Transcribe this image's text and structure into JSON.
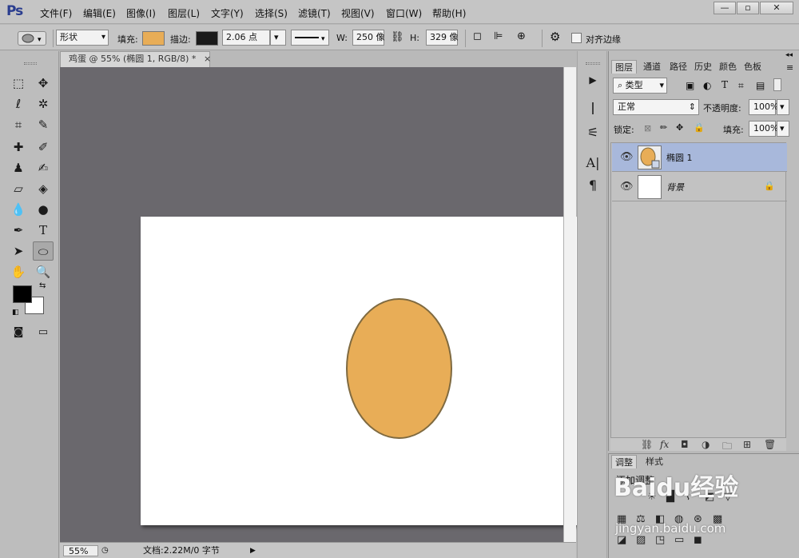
{
  "app": {
    "logo": "Ps"
  },
  "menu": [
    "文件(F)",
    "编辑(E)",
    "图像(I)",
    "图层(L)",
    "文字(Y)",
    "选择(S)",
    "滤镜(T)",
    "视图(V)",
    "窗口(W)",
    "帮助(H)"
  ],
  "window_controls": {
    "minimize": "—",
    "restore": "▫",
    "close": "✕"
  },
  "options": {
    "mode": "形状",
    "fill_label": "填充:",
    "fill_color": "#e8ad57",
    "stroke_label": "描边:",
    "stroke_color": "#1a1a1a",
    "stroke_width": "2.06 点",
    "w_label": "W:",
    "w_value": "250 像",
    "h_label": "H:",
    "h_value": "329 像",
    "align_edges_label": "对齐边缘"
  },
  "document": {
    "tab_title": "鸡蛋 @ 55% (椭圆 1, RGB/8) *",
    "close": "×",
    "zoom": "55%",
    "doc_info": "文档:2.22M/0 字节",
    "shape_color": "#e8ad57"
  },
  "tools": {
    "fg_color": "#000000",
    "bg_color": "#ffffff"
  },
  "layers_panel": {
    "tabs": [
      "图层",
      "通道",
      "路径",
      "历史",
      "颜色",
      "色板"
    ],
    "filter_kind": "类型",
    "blend_mode": "正常",
    "opacity_label": "不透明度:",
    "opacity_value": "100%",
    "lock_label": "锁定:",
    "fill_label": "填充:",
    "fill_value": "100%",
    "layers": [
      {
        "name": "椭圆 1",
        "visible_icon": "eye-icon",
        "selected": true
      },
      {
        "name": "背景",
        "visible_icon": "eye-icon",
        "locked": true
      }
    ]
  },
  "adjustments_panel": {
    "tabs": [
      "调整",
      "样式"
    ],
    "heading": "添加调整"
  },
  "watermark": {
    "brand": "Baidu经验",
    "url": "jingyan.baidu.com"
  }
}
